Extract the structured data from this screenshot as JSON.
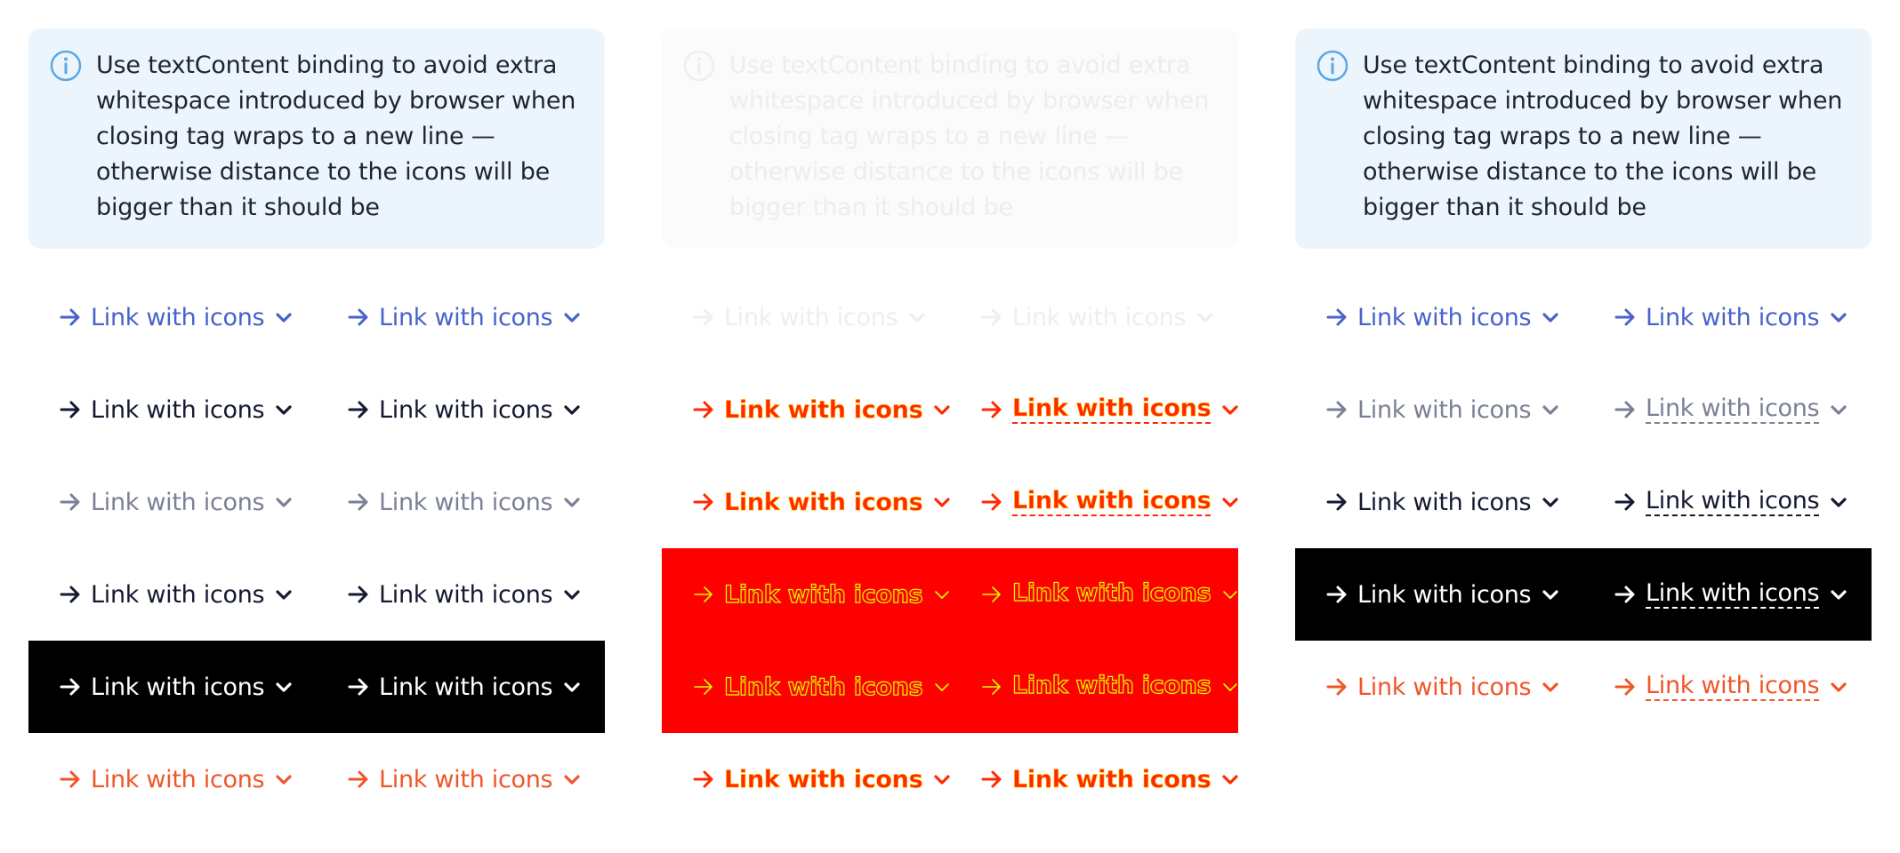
{
  "info_text": "Use textContent binding to avoid extra whitespace introduced by browser when closing tag wraps to a new line — otherwise distance to the icons will be bigger than it should be",
  "link_label": "Link with icons",
  "icons": {
    "info": "info-circle-icon",
    "leading": "arrow-right-icon",
    "trailing": "chevron-down-icon"
  },
  "colors": {
    "info_background": "#edf5fc",
    "info_icon": "#5aa8e6",
    "primary": "#4763cc",
    "dark": "#151a31",
    "secondary": "#7b8096",
    "inverted": "#ffffff",
    "danger": "#f0562a",
    "highlight_red": "#ff0000",
    "black": "#000000"
  }
}
